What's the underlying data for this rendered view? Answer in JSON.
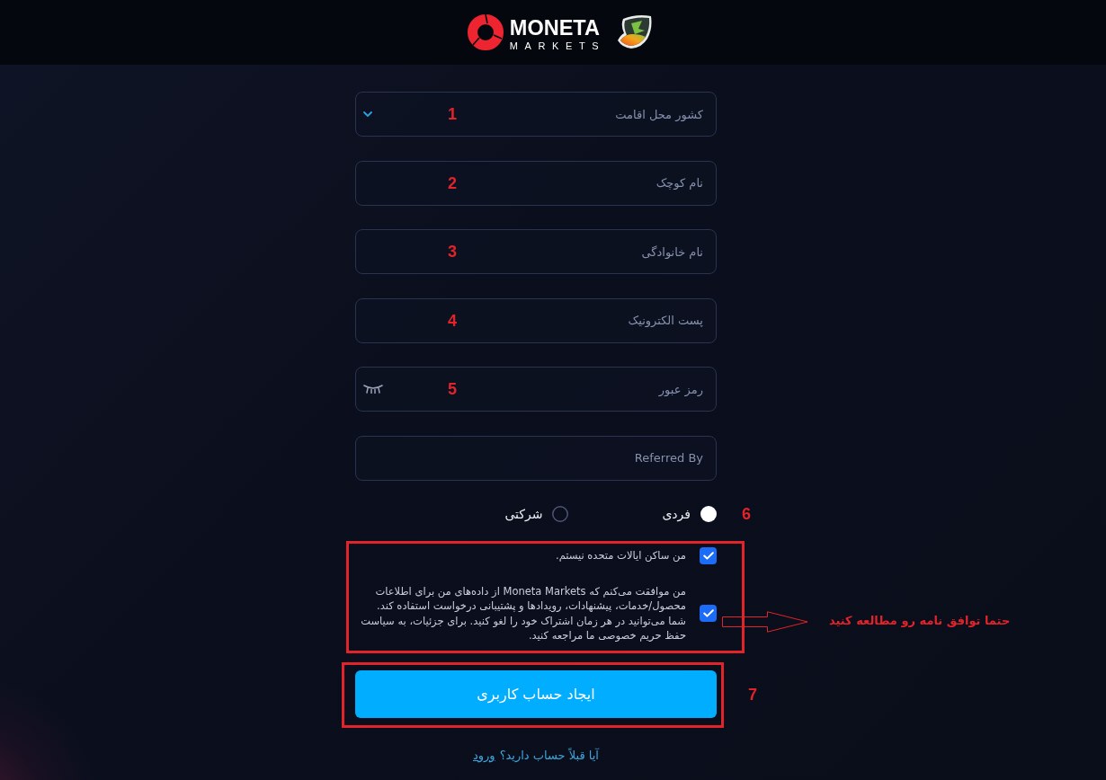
{
  "header": {
    "brand_name": "MONETA",
    "brand_tagline": "MARKETS"
  },
  "fields": [
    {
      "kind": "select",
      "placeholder": "کشور محل اقامت",
      "annotation": "1"
    },
    {
      "kind": "text",
      "placeholder": "نام کوچک",
      "annotation": "2"
    },
    {
      "kind": "text",
      "placeholder": "نام خانوادگی",
      "annotation": "3"
    },
    {
      "kind": "text",
      "placeholder": "پست الکترونیک",
      "annotation": "4"
    },
    {
      "kind": "password",
      "placeholder": "رمز عبور",
      "annotation": "5"
    },
    {
      "kind": "text",
      "placeholder": "Referred By"
    }
  ],
  "account_type": {
    "annotation": "6",
    "options": [
      {
        "label": "فردی",
        "selected": true
      },
      {
        "label": "شرکتی",
        "selected": false
      }
    ]
  },
  "consents": {
    "highlighted": true,
    "items": [
      {
        "text": "من ساکن ایالات متحده نیستم.",
        "checked": true
      },
      {
        "text": "من موافقت می‌کنم که Moneta Markets از داده‌های من برای اطلاعات محصول/خدمات، پیشنهادات، رویدادها و پشتیبانی درخواست استفاده کند. شما می‌توانید در هر زمان اشتراک خود را لغو کنید. برای جزئیات، به سیاست حفظ حریم خصوصی ما مراجعه کنید.",
        "checked": true
      }
    ],
    "note": "حتما توافق نامه رو مطالعه کنید"
  },
  "submit": {
    "label": "ایجاد حساب کاربری",
    "highlighted": true,
    "annotation": "7"
  },
  "login": {
    "prompt": "آیا قبلاً حساب دارید؟",
    "link": "ورود"
  }
}
